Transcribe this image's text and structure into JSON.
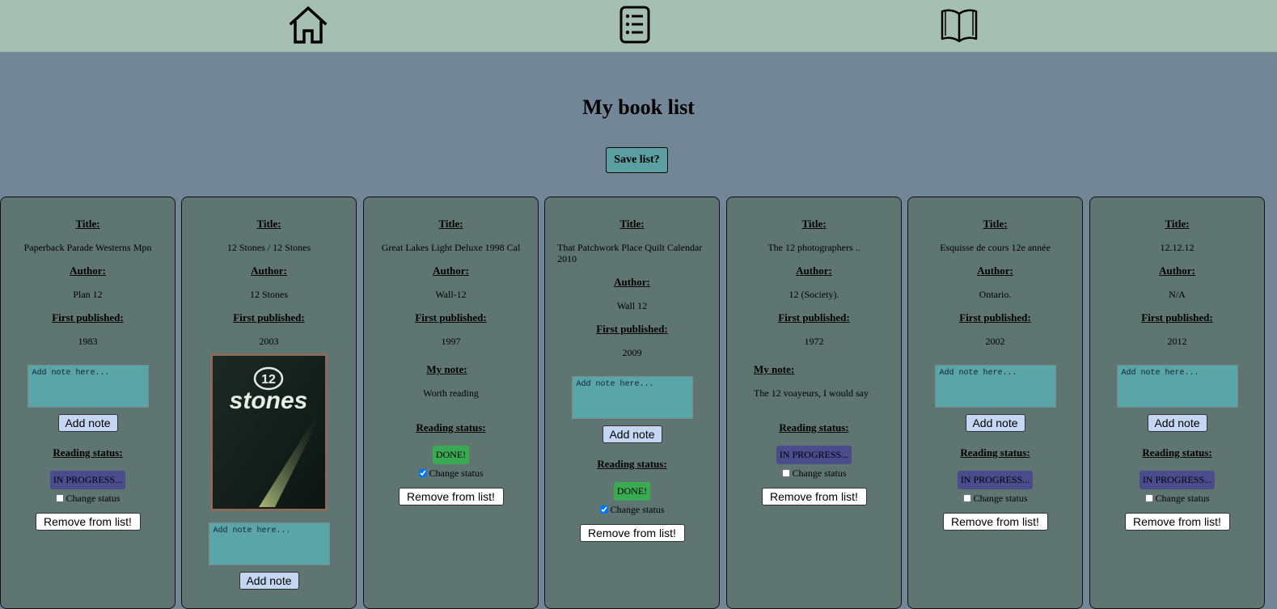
{
  "nav": {
    "icons": [
      "home-icon",
      "list-icon",
      "book-open-icon"
    ]
  },
  "page_title": "My book list",
  "save_label": "Save list?",
  "labels": {
    "title": "Title:",
    "author": "Author:",
    "first_published": "First published:",
    "my_note": "My note:",
    "reading_status": "Reading status:",
    "change_status": "Change status",
    "add_note": "Add note",
    "remove": "Remove from list!",
    "note_placeholder": "Add note here..."
  },
  "colors": {
    "navbar": "#a6bfb3",
    "page_bg": "#738697",
    "card_bg": "#5e7572",
    "note_box": "#5aa5a8",
    "status_in_progress": "#4a4c8e",
    "status_done": "#3bab53",
    "add_button": "#c4d6f2",
    "save_button": "#5b9fa2"
  },
  "books": [
    {
      "title": "Paperback Parade Westerns Mpn",
      "author": "Plan 12",
      "first_published": "1983",
      "note": "",
      "status": "IN PROGRESS...",
      "status_checked": false
    },
    {
      "title": "12 Stones / 12 Stones",
      "author": "12 Stones",
      "first_published": "2003",
      "note": "",
      "cover_text": "12 stones"
    },
    {
      "title": "Great Lakes Light Deluxe 1998 Cal",
      "author": "Wall-12",
      "first_published": "1997",
      "note": "Worth reading",
      "status": "DONE!",
      "status_checked": true
    },
    {
      "title": "That Patchwork Place Quilt Calendar 2010",
      "author": "Wall 12",
      "first_published": "2009",
      "note": "",
      "status": "DONE!",
      "status_checked": true
    },
    {
      "title": "The 12 photographers ..",
      "author": "12 (Society).",
      "first_published": "1972",
      "note": "The 12 voayeurs, I would say",
      "status": "IN PROGRESS...",
      "status_checked": false
    },
    {
      "title": "Esquisse de cours 12e année",
      "author": "Ontario.",
      "first_published": "2002",
      "note": "",
      "status": "IN PROGRESS...",
      "status_checked": false
    },
    {
      "title": "12.12.12",
      "author": "N/A",
      "first_published": "2012",
      "note": "",
      "status": "IN PROGRESS...",
      "status_checked": false
    }
  ]
}
